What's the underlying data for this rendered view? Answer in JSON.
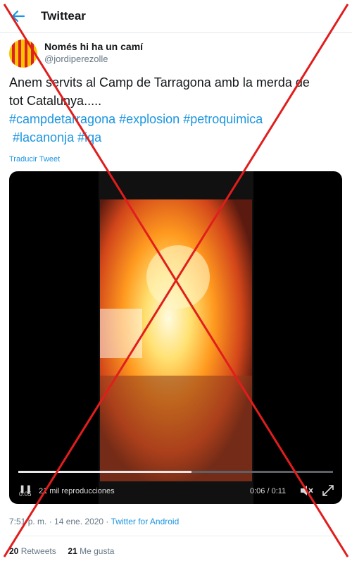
{
  "header": {
    "title": "Twittear"
  },
  "author": {
    "name": "Només hi ha un camí",
    "handle": "@jordiperezolle"
  },
  "tweet": {
    "lines": [
      "Anem servits al Camp de Tarragona amb la merda de",
      "tot Catalunya....."
    ],
    "hashtags_line1": [
      "#campdetarragona",
      "#explosion",
      "#petroquimica"
    ],
    "hashtags_line2": [
      "#lacanonja",
      "#iqa"
    ],
    "translate": "Traducir Tweet"
  },
  "video": {
    "views": "21 mil reproducciones",
    "time": "0:06 / 0:11",
    "elapsed": "0:05",
    "progress": 0.55
  },
  "meta": {
    "time": "7:51 p. m. · 14 ene. 2020 ·",
    "source": "Twitter for Android"
  },
  "stats": {
    "retweets_count": "20",
    "retweets_label": "Retweets",
    "likes_count": "21",
    "likes_label": "Me gusta"
  },
  "colors": {
    "accent": "#1b95e0",
    "cross": "#e11d1d",
    "fire": "#ff9a1f"
  }
}
